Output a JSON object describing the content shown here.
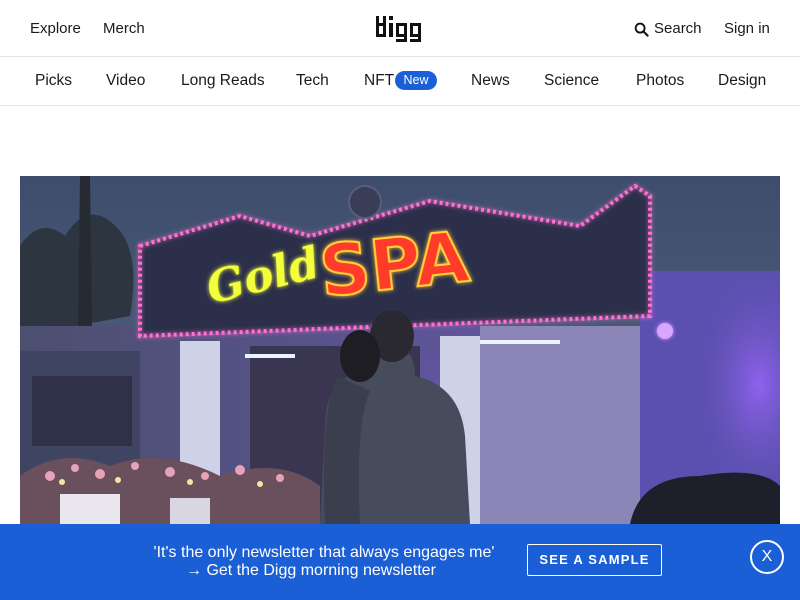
{
  "topbar": {
    "explore": "Explore",
    "merch": "Merch",
    "logo_text": "digg",
    "search": "Search",
    "signin": "Sign in"
  },
  "nav": {
    "items": [
      "Picks",
      "Video",
      "Long Reads",
      "Tech",
      "NFT",
      "News",
      "Science",
      "Photos",
      "Design"
    ],
    "nft_badge": "New"
  },
  "hero": {
    "sign_script": "Gold",
    "sign_main": "SPA"
  },
  "banner": {
    "quote": "'It's the only newsletter that always engages me'",
    "subline": "→  Get the Digg morning newsletter",
    "button": "SEE A SAMPLE",
    "close": "X"
  },
  "colors": {
    "accent": "#1b5fd6",
    "sign_red": "#ff3a2a",
    "sign_yellow": "#f4ff3a"
  }
}
